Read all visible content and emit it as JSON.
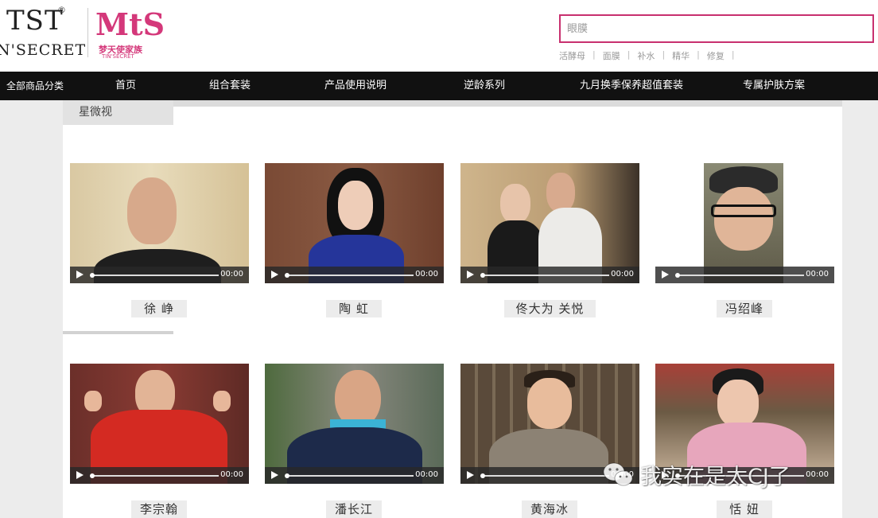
{
  "brand": {
    "logo_main": "TST",
    "logo_registered": "®",
    "logo_sub": "N'SECRET",
    "mts_logo": "MtS",
    "mts_cn": "梦天使家族",
    "mts_en": "TIN'SECRET"
  },
  "search": {
    "placeholder": "眼膜",
    "hot_keywords": [
      "活酵母",
      "面膜",
      "补水",
      "精华",
      "修复"
    ],
    "accent_color": "#c8306f"
  },
  "nav": {
    "items": [
      "全部商品分类",
      "首页",
      "组合套装",
      "产品使用说明",
      "逆龄系列",
      "九月换季保养超值套装",
      "专属护肤方案"
    ]
  },
  "section": {
    "title": "星微视"
  },
  "videos": [
    {
      "name": "徐 峥",
      "time": "00:00"
    },
    {
      "name": "陶 虹",
      "time": "00:00"
    },
    {
      "name": "佟大为 关悦",
      "time": "00:00"
    },
    {
      "name": "冯绍峰",
      "time": "00:00"
    },
    {
      "name": "李宗翰",
      "time": "00:00"
    },
    {
      "name": "潘长江",
      "time": "00:00"
    },
    {
      "name": "黄海冰",
      "time": "00:00"
    },
    {
      "name": "恬 妞",
      "time": "00:00"
    }
  ],
  "watermark": {
    "text": "我实在是太CJ了"
  }
}
